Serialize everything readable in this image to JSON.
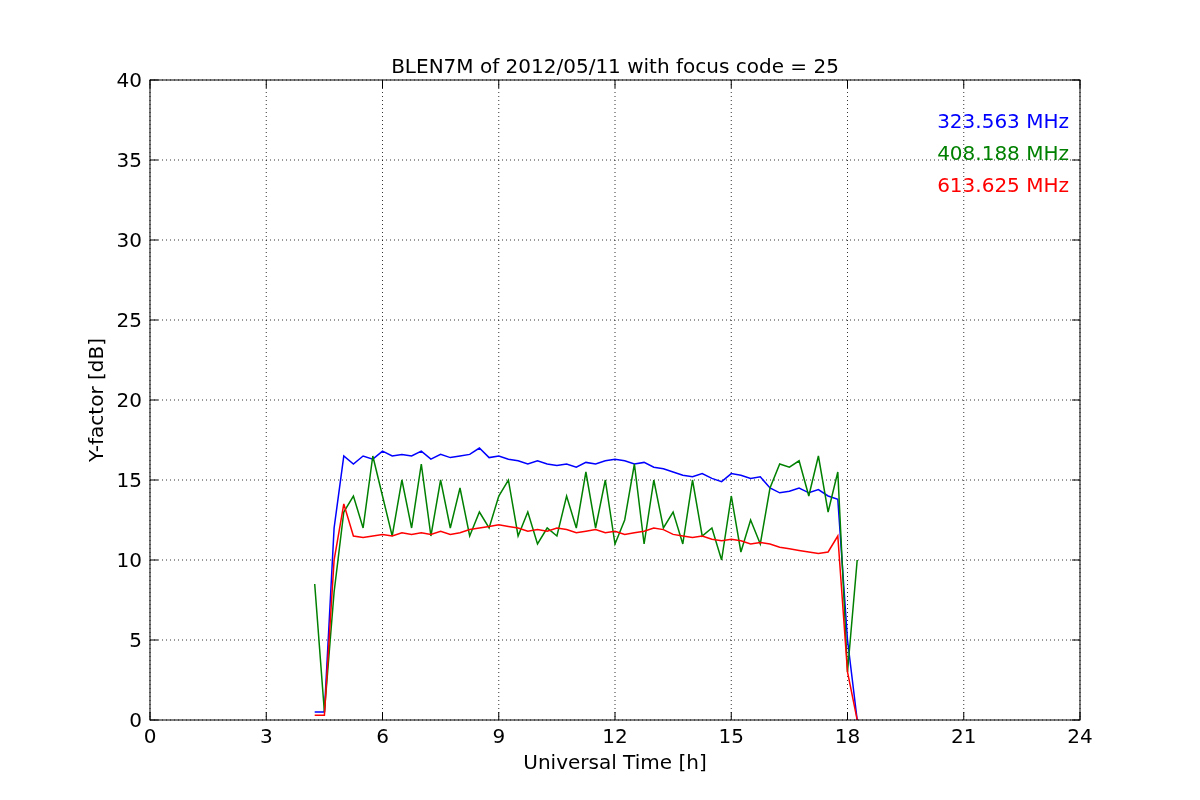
{
  "figure": {
    "chart_data": {
      "type": "line",
      "title": "BLEN7M of 2012/05/11 with focus code = 25",
      "xlabel": "Universal Time [h]",
      "ylabel": "Y-factor [dB]",
      "x": [
        4.25,
        4.5,
        4.75,
        5,
        5.25,
        5.5,
        5.75,
        6,
        6.25,
        6.5,
        6.75,
        7,
        7.25,
        7.5,
        7.75,
        8,
        8.25,
        8.5,
        8.75,
        9,
        9.25,
        9.5,
        9.75,
        10,
        10.25,
        10.5,
        10.75,
        11,
        11.25,
        11.5,
        11.75,
        12,
        12.25,
        12.5,
        12.75,
        13,
        13.25,
        13.5,
        13.75,
        14,
        14.25,
        14.5,
        14.75,
        15,
        15.25,
        15.5,
        15.75,
        16,
        16.25,
        16.5,
        16.75,
        17,
        17.25,
        17.5,
        17.75,
        18,
        18.25
      ],
      "series": [
        {
          "name": "323.563 MHz",
          "color": "#0000ff",
          "values": [
            0.5,
            0.5,
            12,
            16.5,
            16,
            16.5,
            16.3,
            16.8,
            16.5,
            16.6,
            16.5,
            16.8,
            16.3,
            16.6,
            16.4,
            16.5,
            16.6,
            17,
            16.4,
            16.5,
            16.3,
            16.2,
            16,
            16.2,
            16,
            15.9,
            16,
            15.8,
            16.1,
            16,
            16.2,
            16.3,
            16.2,
            16,
            16.1,
            15.8,
            15.7,
            15.5,
            15.3,
            15.2,
            15.4,
            15.1,
            14.9,
            15.4,
            15.3,
            15.1,
            15.2,
            14.5,
            14.2,
            14.3,
            14.5,
            14.2,
            14.4,
            14,
            13.8,
            5,
            0
          ]
        },
        {
          "name": "408.188 MHz",
          "color": "#008000",
          "values": [
            8.5,
            0.5,
            8,
            13,
            14,
            12,
            16.5,
            14,
            11.5,
            15,
            12,
            16,
            11.5,
            15,
            12,
            14.5,
            11.5,
            13,
            12,
            14,
            15,
            11.5,
            13,
            11,
            12,
            11.5,
            14,
            12,
            15.5,
            12,
            15,
            11,
            12.5,
            16,
            11,
            15,
            12,
            13,
            11,
            15,
            11.5,
            12,
            10,
            14,
            10.5,
            12.5,
            11,
            14.5,
            16,
            15.8,
            16.2,
            14,
            16.5,
            13,
            15.5,
            3,
            10
          ]
        },
        {
          "name": "613.625 MHz",
          "color": "#ff0000",
          "values": [
            0.3,
            0.3,
            10,
            13.5,
            11.5,
            11.4,
            11.5,
            11.6,
            11.5,
            11.7,
            11.6,
            11.7,
            11.6,
            11.8,
            11.6,
            11.7,
            11.9,
            12,
            12.1,
            12.2,
            12.1,
            12,
            11.8,
            11.9,
            11.8,
            12,
            11.9,
            11.7,
            11.8,
            11.9,
            11.7,
            11.8,
            11.6,
            11.7,
            11.8,
            12,
            11.9,
            11.6,
            11.5,
            11.4,
            11.5,
            11.3,
            11.2,
            11.3,
            11.2,
            11,
            11.1,
            11,
            10.8,
            10.7,
            10.6,
            10.5,
            10.4,
            10.5,
            11.5,
            3,
            0
          ]
        }
      ],
      "xlim": [
        0,
        24
      ],
      "ylim": [
        0,
        40
      ],
      "xticks": [
        0,
        3,
        6,
        9,
        12,
        15,
        18,
        21,
        24
      ],
      "yticks": [
        0,
        5,
        10,
        15,
        20,
        25,
        30,
        35,
        40
      ],
      "grid": true
    }
  }
}
